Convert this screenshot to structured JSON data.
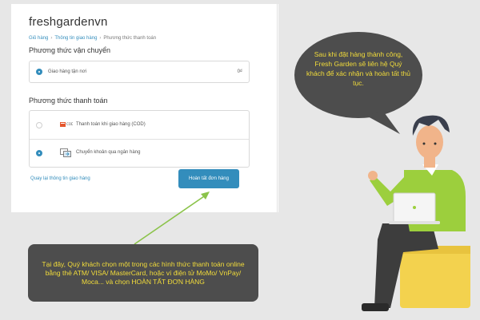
{
  "checkout": {
    "brand": "freshgardenvn",
    "breadcrumb": [
      "Giỏ hàng",
      "Thông tin giao hàng",
      "Phương thức thanh toán"
    ],
    "shipping": {
      "title": "Phương thức vận chuyển",
      "option_label": "Giao hàng tận nơi",
      "option_price": "0₫"
    },
    "payment": {
      "title": "Phương thức thanh toán",
      "options": [
        {
          "label": "Thanh toán khi giao hàng (COD)",
          "icon": "cod-icon",
          "selected": false
        },
        {
          "label": "Chuyển khoản qua ngân hàng",
          "icon": "bank-transfer-icon",
          "selected": true
        }
      ]
    },
    "back_link": "Quay lại thông tin giao hàng",
    "finish_button": "Hoàn tất đơn hàng"
  },
  "annotations": {
    "speech_bubble": "Sau khi đặt hàng thành công, Fresh Garden sẽ liên hệ Quý khách để xác nhận và hoàn tất thủ tục.",
    "instruction": "Tại đây, Quý khách chọn một trong các hình thức thanh toán online bằng thẻ ATM/ VISA/ MasterCard, hoặc ví điện tử MoMo/ VnPay/ Moca... và chọn HOÀN TẤT ĐƠN HÀNG"
  },
  "colors": {
    "accent": "#338dbc",
    "annotation_bg": "#4d4d4d",
    "annotation_text": "#f2dc3a",
    "character_shirt": "#9ccf3d",
    "seat": "#f3d24e"
  }
}
